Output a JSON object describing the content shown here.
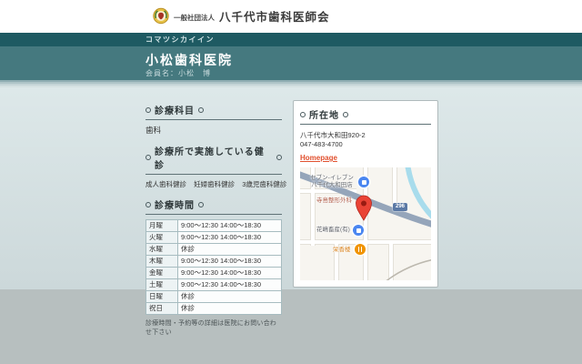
{
  "header": {
    "org_prefix": "一般社団法人",
    "org_name": "八千代市歯科医師会"
  },
  "clinic": {
    "kana": "コマツシカイイン",
    "name": "小松歯科医院",
    "member": "会員名：小松　博"
  },
  "sections": {
    "departments": {
      "title": "診療科目",
      "value": "歯科"
    },
    "checkups": {
      "title": "診療所で実施している健診",
      "items": [
        "成人歯科健診",
        "妊婦歯科健診",
        "3歳児歯科健診"
      ]
    },
    "hours": {
      "title": "診療時間",
      "rows": [
        {
          "day": "月曜",
          "time": "9:00〜12:30 14:00〜18:30"
        },
        {
          "day": "火曜",
          "time": "9:00〜12:30 14:00〜18:30"
        },
        {
          "day": "水曜",
          "time": "休診"
        },
        {
          "day": "木曜",
          "time": "9:00〜12:30 14:00〜18:30"
        },
        {
          "day": "金曜",
          "time": "9:00〜12:30 14:00〜18:30"
        },
        {
          "day": "土曜",
          "time": "9:00〜12:30 14:00〜18:30"
        },
        {
          "day": "日曜",
          "time": "休診"
        },
        {
          "day": "祝日",
          "time": "休診"
        }
      ],
      "note": "診療時間・予約等の詳細は医院にお問い合わせ下さい"
    },
    "location": {
      "title": "所在地",
      "address": "八千代市大和田920-2",
      "phone": "047-483-4700",
      "homepage_label": "Homepage"
    }
  },
  "map": {
    "store_line1": "セブン-イレブン",
    "store_line2": "八千代大和田店",
    "hospital": "寺島整形外科",
    "company": "花嶋畜産(有)",
    "restaurant": "栄香楼",
    "route_shield": "296"
  },
  "colors": {
    "band_teal": "#45797f",
    "strip_teal": "#1e5a62",
    "content_bg": "#d5e0e2",
    "link_red": "#e1502e",
    "pin_red": "#ea4335",
    "route_blue": "#5b79a5"
  }
}
